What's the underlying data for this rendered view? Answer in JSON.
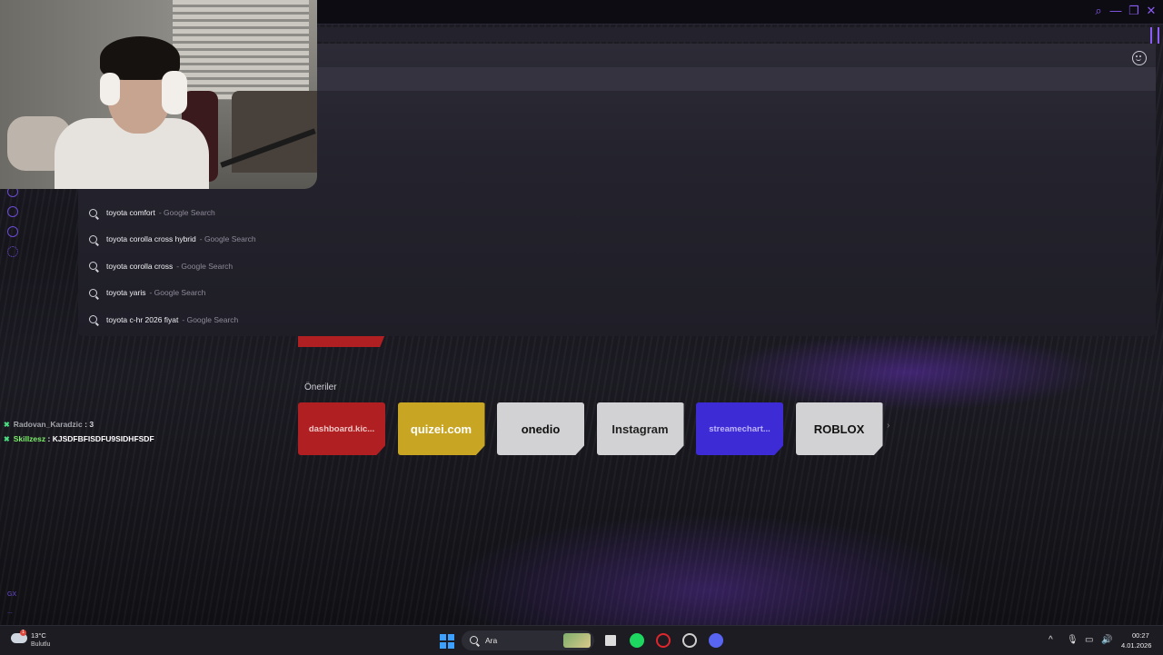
{
  "search": {
    "suggestions": [
      {
        "query": "toyota comfort",
        "source": "- Google Search"
      },
      {
        "query": "toyota corolla cross hybrid",
        "source": "- Google Search"
      },
      {
        "query": "toyota corolla cross",
        "source": "- Google Search"
      },
      {
        "query": "toyota yaris",
        "source": "- Google Search"
      },
      {
        "query": "toyota c-hr 2026 fiyat",
        "source": "- Google Search"
      }
    ]
  },
  "speed_dial": {
    "section_title": "Öneriler",
    "tiles": [
      {
        "label": "dashboard.kic...",
        "color": "#b01f21",
        "text_color": "#f3c9c9"
      },
      {
        "label": "quizei.com",
        "color": "#c9a524",
        "text_color": "#ffffff"
      },
      {
        "label": "onedio",
        "color": "#d2d2d4",
        "text_color": "#111111"
      },
      {
        "label": "Instagram",
        "color": "#d2d2d4",
        "text_color": "#222222"
      },
      {
        "label": "streamechart...",
        "color": "#3d2bd6",
        "text_color": "#bfb5ff"
      },
      {
        "label": "ROBLOX",
        "color": "#d2d2d4",
        "text_color": "#111111"
      }
    ]
  },
  "chat": [
    {
      "user": "Radovan_Karadzic",
      "message": ": 3"
    },
    {
      "user": "Skillzesz",
      "message": ": KJSDFBFISDFU9SIDHFSDF"
    }
  ],
  "sidebar": {
    "gx_label": "GX",
    "more_label": "..."
  },
  "window_controls": {
    "search": "⌕",
    "minimize": "—",
    "restore": "❐",
    "close": "✕"
  },
  "taskbar": {
    "weather_temp": "13°C",
    "weather_desc": "Bulutlu",
    "weather_badge": "1",
    "search_label": "Ara",
    "time": "00:27",
    "date": "4.01.2026",
    "tray_chevron": "^",
    "tray_mic": "🎙",
    "tray_display": "▭",
    "tray_volume": "🔊"
  },
  "colors": {
    "accent": "#8b5cf6",
    "spotify": "#1ed760",
    "opera": "#e0262d",
    "discord": "#5865f2"
  }
}
